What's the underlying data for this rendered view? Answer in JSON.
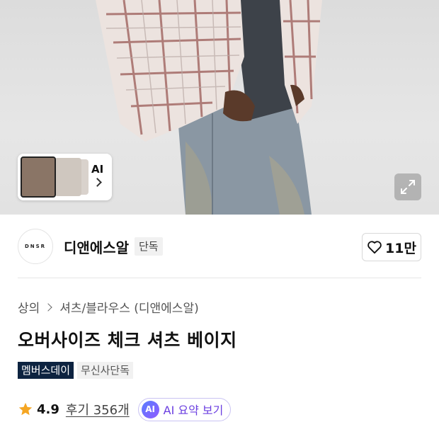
{
  "hero": {
    "gallery_label": "AI"
  },
  "brand": {
    "logo_text": "DNSR",
    "name": "디앤에스알",
    "badge": "단독",
    "like_count": "11만"
  },
  "product": {
    "breadcrumb": [
      "상의",
      "셔츠/블라우스 (디앤에스알)"
    ],
    "title": "오버사이즈 체크 셔츠 베이지",
    "tags": [
      "멤버스데이",
      "무신사단독"
    ],
    "rating": "4.9",
    "reviews": "후기 356개",
    "ai_summary": {
      "icon_text": "AI",
      "label": "AI 요약 보기"
    }
  },
  "colors": {
    "tag_dark": "#0d2340",
    "star": "#f5a623",
    "ai_purple": "#6b3fe0"
  }
}
